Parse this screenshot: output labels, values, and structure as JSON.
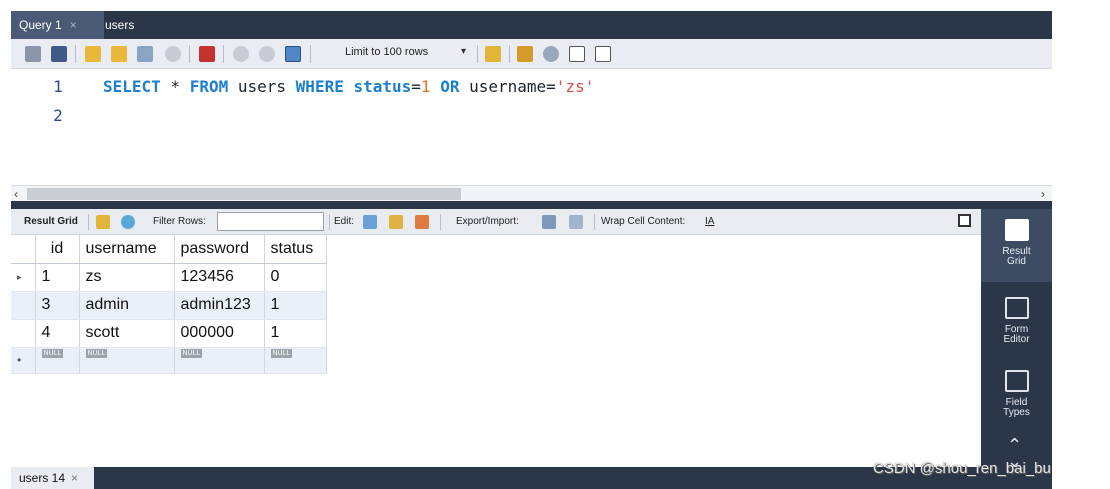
{
  "tabs": [
    {
      "label": "Query 1",
      "close": "×"
    },
    {
      "label": "users"
    }
  ],
  "toolbar": {
    "limit_label": "Limit to 100 rows",
    "limit_caret": "▾"
  },
  "editor": {
    "lines": [
      "1",
      "2"
    ],
    "sql": {
      "t1": "SELECT",
      "t2": " * ",
      "t3": "FROM",
      "t4": " users ",
      "t5": "WHERE",
      "t6": " ",
      "t7": "status",
      "t8": "=",
      "t9": "1",
      "t10": " ",
      "t11": "OR",
      "t12": " username=",
      "t13": "'zs'"
    }
  },
  "scroll": {
    "left": "‹",
    "right": "›"
  },
  "result_bar": {
    "result_grid": "Result Grid",
    "filter_rows": "Filter Rows:",
    "filter_value": "",
    "edit": "Edit:",
    "export_import": "Export/Import:",
    "wrap": "Wrap Cell Content:",
    "wrap_icon": "IA"
  },
  "grid": {
    "columns": [
      "id",
      "username",
      "password",
      "status"
    ],
    "rows": [
      [
        "1",
        "zs",
        "123456",
        "0"
      ],
      [
        "3",
        "admin",
        "admin123",
        "1"
      ],
      [
        "4",
        "scott",
        "000000",
        "1"
      ]
    ],
    "null_label": "NULL",
    "current_marker": "▸",
    "new_marker": "•"
  },
  "side_panel": {
    "items": [
      {
        "label": "Result Grid"
      },
      {
        "label": "Form Editor"
      },
      {
        "label": "Field Types"
      }
    ],
    "arrows": {
      "up": "⌃",
      "down": "⌄"
    }
  },
  "bottom_tab": {
    "label": "users 14",
    "close": "×"
  },
  "watermark": "CSDN @shou_ren_bai_bu"
}
